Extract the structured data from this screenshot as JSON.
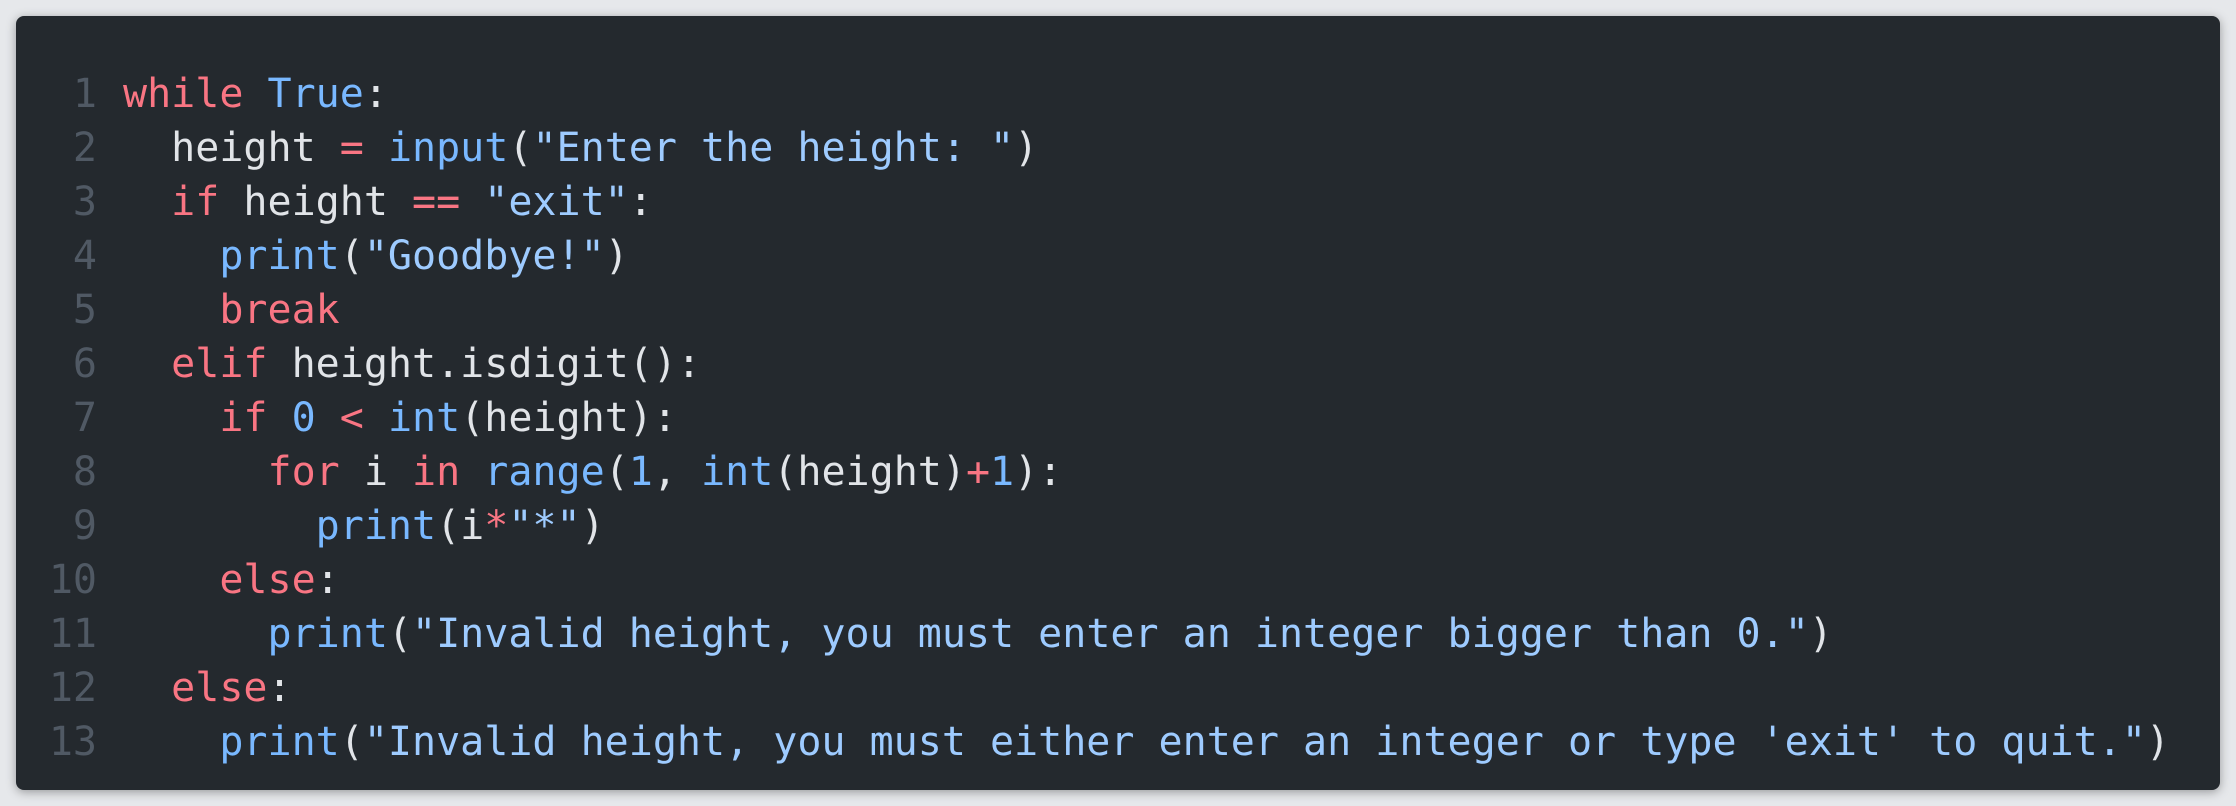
{
  "editor": {
    "lines": [
      {
        "n": "1",
        "tokens": [
          {
            "t": "while",
            "c": "kw"
          },
          {
            "t": " ",
            "c": "plain"
          },
          {
            "t": "True",
            "c": "fn"
          },
          {
            "t": ":",
            "c": "plain"
          }
        ]
      },
      {
        "n": "2",
        "tokens": [
          {
            "t": "  height ",
            "c": "plain"
          },
          {
            "t": "=",
            "c": "op"
          },
          {
            "t": " ",
            "c": "plain"
          },
          {
            "t": "input",
            "c": "fn"
          },
          {
            "t": "(",
            "c": "plain"
          },
          {
            "t": "\"Enter the height: \"",
            "c": "str"
          },
          {
            "t": ")",
            "c": "plain"
          }
        ]
      },
      {
        "n": "3",
        "tokens": [
          {
            "t": "  ",
            "c": "plain"
          },
          {
            "t": "if",
            "c": "kw"
          },
          {
            "t": " height ",
            "c": "plain"
          },
          {
            "t": "==",
            "c": "op"
          },
          {
            "t": " ",
            "c": "plain"
          },
          {
            "t": "\"exit\"",
            "c": "str"
          },
          {
            "t": ":",
            "c": "plain"
          }
        ]
      },
      {
        "n": "4",
        "tokens": [
          {
            "t": "    ",
            "c": "plain"
          },
          {
            "t": "print",
            "c": "fn"
          },
          {
            "t": "(",
            "c": "plain"
          },
          {
            "t": "\"Goodbye!\"",
            "c": "str"
          },
          {
            "t": ")",
            "c": "plain"
          }
        ]
      },
      {
        "n": "5",
        "tokens": [
          {
            "t": "    ",
            "c": "plain"
          },
          {
            "t": "break",
            "c": "kw"
          }
        ]
      },
      {
        "n": "6",
        "tokens": [
          {
            "t": "  ",
            "c": "plain"
          },
          {
            "t": "elif",
            "c": "kw"
          },
          {
            "t": " height.isdigit():",
            "c": "plain"
          }
        ]
      },
      {
        "n": "7",
        "tokens": [
          {
            "t": "    ",
            "c": "plain"
          },
          {
            "t": "if",
            "c": "kw"
          },
          {
            "t": " ",
            "c": "plain"
          },
          {
            "t": "0",
            "c": "num"
          },
          {
            "t": " ",
            "c": "plain"
          },
          {
            "t": "<",
            "c": "op"
          },
          {
            "t": " ",
            "c": "plain"
          },
          {
            "t": "int",
            "c": "fn"
          },
          {
            "t": "(height):",
            "c": "plain"
          }
        ]
      },
      {
        "n": "8",
        "tokens": [
          {
            "t": "      ",
            "c": "plain"
          },
          {
            "t": "for",
            "c": "kw"
          },
          {
            "t": " i ",
            "c": "plain"
          },
          {
            "t": "in",
            "c": "kw"
          },
          {
            "t": " ",
            "c": "plain"
          },
          {
            "t": "range",
            "c": "fn"
          },
          {
            "t": "(",
            "c": "plain"
          },
          {
            "t": "1",
            "c": "num"
          },
          {
            "t": ", ",
            "c": "plain"
          },
          {
            "t": "int",
            "c": "fn"
          },
          {
            "t": "(height)",
            "c": "plain"
          },
          {
            "t": "+",
            "c": "op"
          },
          {
            "t": "1",
            "c": "num"
          },
          {
            "t": "):",
            "c": "plain"
          }
        ]
      },
      {
        "n": "9",
        "tokens": [
          {
            "t": "        ",
            "c": "plain"
          },
          {
            "t": "print",
            "c": "fn"
          },
          {
            "t": "(i",
            "c": "plain"
          },
          {
            "t": "*",
            "c": "op"
          },
          {
            "t": "\"*\"",
            "c": "str"
          },
          {
            "t": ")",
            "c": "plain"
          }
        ]
      },
      {
        "n": "10",
        "tokens": [
          {
            "t": "    ",
            "c": "plain"
          },
          {
            "t": "else",
            "c": "kw"
          },
          {
            "t": ":",
            "c": "plain"
          }
        ]
      },
      {
        "n": "11",
        "tokens": [
          {
            "t": "      ",
            "c": "plain"
          },
          {
            "t": "print",
            "c": "fn"
          },
          {
            "t": "(",
            "c": "plain"
          },
          {
            "t": "\"Invalid height, you must enter an integer bigger than 0.\"",
            "c": "str"
          },
          {
            "t": ")",
            "c": "plain"
          }
        ]
      },
      {
        "n": "12",
        "tokens": [
          {
            "t": "  ",
            "c": "plain"
          },
          {
            "t": "else",
            "c": "kw"
          },
          {
            "t": ":",
            "c": "plain"
          }
        ]
      },
      {
        "n": "13",
        "tokens": [
          {
            "t": "    ",
            "c": "plain"
          },
          {
            "t": "print",
            "c": "fn"
          },
          {
            "t": "(",
            "c": "plain"
          },
          {
            "t": "\"Invalid height, you must either enter an integer or type 'exit' to quit.\"",
            "c": "str"
          },
          {
            "t": ")",
            "c": "plain"
          }
        ]
      }
    ]
  },
  "colors": {
    "background": "#24292e",
    "keyword": "#f97583",
    "builtin": "#79b8ff",
    "string": "#9ecbff",
    "text": "#e1e4e8",
    "line_number": "#505964"
  }
}
